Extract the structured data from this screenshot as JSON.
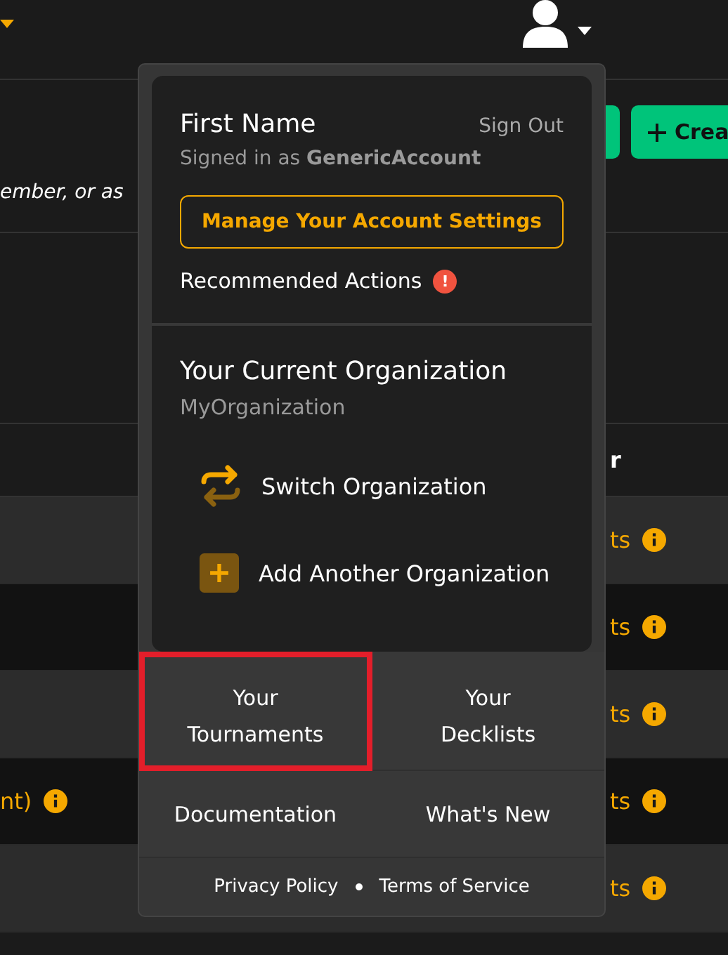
{
  "header": {
    "account_menu_open": true
  },
  "intro": {
    "text": "ember, or as",
    "create_button": "Crea"
  },
  "table": {
    "header_cell": "r",
    "rows": [
      {
        "left": "",
        "right": "ts"
      },
      {
        "left": "",
        "right": "ts"
      },
      {
        "left": "",
        "right": "ts"
      },
      {
        "left": "nt)",
        "right": "ts"
      },
      {
        "left": "",
        "right": "ts"
      }
    ]
  },
  "account_menu": {
    "name": "First Name",
    "sign_out": "Sign Out",
    "signed_in_prefix": "Signed in as ",
    "account": "GenericAccount",
    "settings_button": "Manage Your Account Settings",
    "recommended": "Recommended Actions",
    "alert_badge": "!",
    "org_title": "Your Current Organization",
    "org_name": "MyOrganization",
    "org_actions": [
      {
        "kind": "switch",
        "label": "Switch Organization"
      },
      {
        "kind": "add",
        "label": "Add Another Organization"
      }
    ],
    "tiles": [
      {
        "label": "Your Tournaments",
        "highlighted": true
      },
      {
        "label": "Your Decklists",
        "highlighted": false
      },
      {
        "label": "Documentation",
        "highlighted": false
      },
      {
        "label": "What's New",
        "highlighted": false
      }
    ],
    "footer_links": [
      "Privacy Policy",
      "Terms of Service"
    ]
  }
}
